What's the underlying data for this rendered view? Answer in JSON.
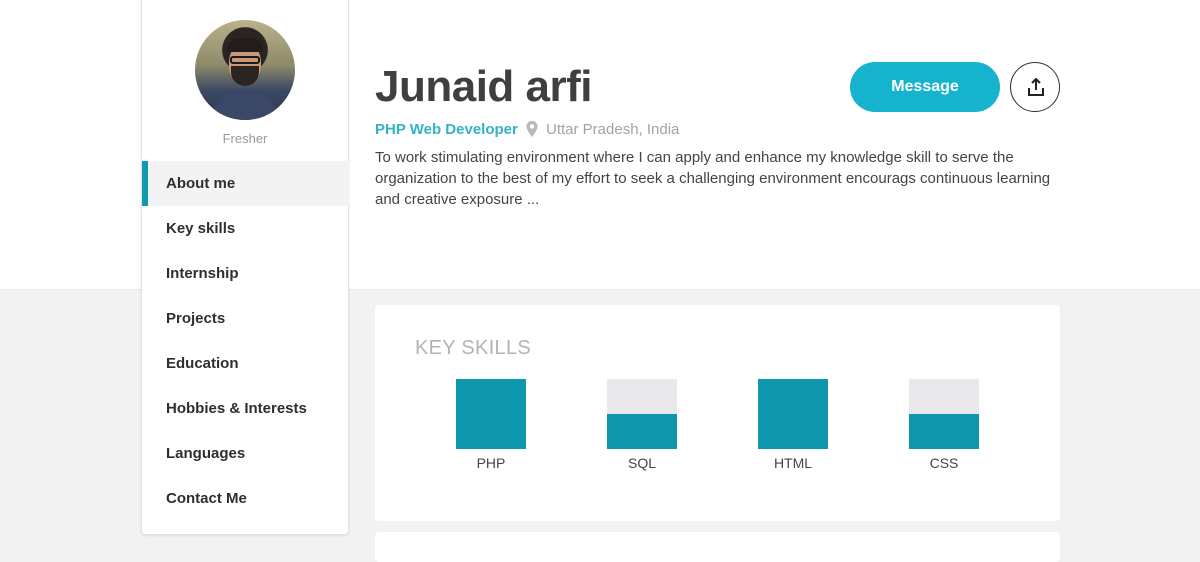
{
  "profile": {
    "name": "Junaid arfi",
    "status": "Fresher",
    "role": "PHP Web Developer",
    "location": "Uttar Pradesh, India",
    "bio": "To work stimulating environment where I can apply and enhance my knowledge skill to serve the organization to the best of my effort to seek a challenging environment encourags continuous learning and creative exposure ..."
  },
  "actions": {
    "message_label": "Message",
    "share_icon": "share-upload-icon"
  },
  "sidebar": {
    "items": [
      {
        "label": "About me",
        "active": true
      },
      {
        "label": "Key skills",
        "active": false
      },
      {
        "label": "Internship",
        "active": false
      },
      {
        "label": "Projects",
        "active": false
      },
      {
        "label": "Education",
        "active": false
      },
      {
        "label": "Hobbies & Interests",
        "active": false
      },
      {
        "label": "Languages",
        "active": false
      },
      {
        "label": "Contact Me",
        "active": false
      }
    ]
  },
  "skills_card": {
    "title": "KEY SKILLS"
  },
  "chart_data": {
    "type": "bar",
    "categories": [
      "PHP",
      "SQL",
      "HTML",
      "CSS"
    ],
    "values": [
      100,
      50,
      100,
      50
    ],
    "ylim": [
      0,
      100
    ],
    "colors": {
      "fill": "#0e97ad",
      "track": "#e9e9ec"
    }
  },
  "colors": {
    "accent": "#16b3cf",
    "role_text": "#33b3c8",
    "active_bar": "#1199b0"
  }
}
